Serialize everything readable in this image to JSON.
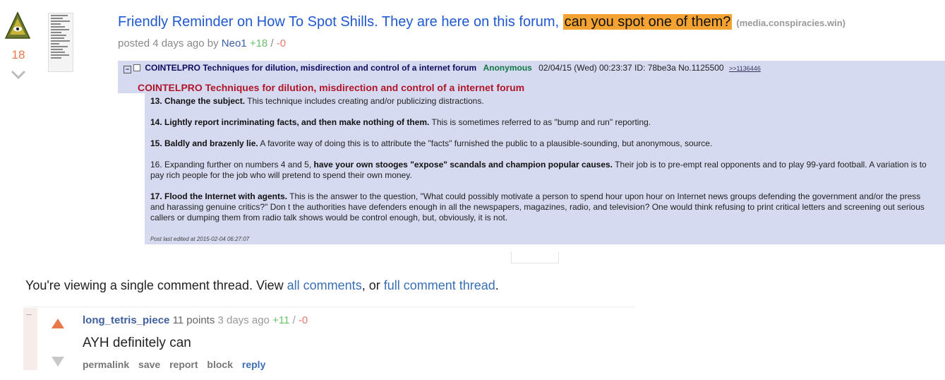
{
  "post": {
    "score": "18",
    "title_main": "Friendly Reminder on How To Spot Shills. They are here on this forum, ",
    "title_highlight": "can you spot one of them?",
    "domain": "(media.conspiracies.win)",
    "posted_prefix": "posted 4 days ago by",
    "author": "Neo1",
    "upvotes": "+18",
    "separator": "/",
    "downvotes": "-0"
  },
  "image": {
    "header_title": "COINTELPRO Techniques for dilution, misdirection and control of a internet forum",
    "header_name": "Anonymous",
    "header_meta": "02/04/15 (Wed) 00:23:37 ID: 78be3a No.1125500",
    "header_ref": ">>1136446",
    "subject": "COINTELPRO Techniques for dilution, misdirection and control of a internet forum",
    "items": [
      {
        "bold": "13. Change the subject.",
        "text": " This technique includes creating and/or publicizing distractions."
      },
      {
        "bold": "14. Lightly report incriminating facts, and then make nothing of them.",
        "text": " This is sometimes referred to as \"bump and run\" reporting."
      },
      {
        "bold": "15. Baldly and brazenly lie.",
        "text": " A favorite way of doing this is to attribute the \"facts\" furnished the public to a plausible-sounding, but anonymous, source."
      },
      {
        "pre": "16. Expanding further on numbers 4 and 5, ",
        "bold": "have your own stooges \"expose\" scandals and champion popular causes.",
        "text": " Their job is to pre-empt real opponents and to play 99-yard football. A variation is to pay rich people for the job who will pretend to spend their own money."
      },
      {
        "bold": "17. Flood the Internet with agents.",
        "text": " This is the answer to the question, \"What could possibly motivate a person to spend hour upon hour on Internet news groups defending the government and/or the press and harassing genuine critics?\" Don t the authorities have defenders enough in all the newspapers, magazines, radio, and television? One would think refusing to print critical letters and screening out serious callers or dumping them from radio talk shows would be control enough, but, obviously, it is not."
      }
    ],
    "edited": "Post last edited at 2015-02-04 06:27:07"
  },
  "thread_note": {
    "prefix": "You're viewing a single comment thread. View ",
    "link1": "all comments",
    "middle": ", or ",
    "link2": "full comment thread",
    "suffix": "."
  },
  "comment": {
    "collapse": "–",
    "user": "long_tetris_piece",
    "points": "11 points",
    "time": "3 days ago",
    "upvotes": "+11",
    "separator": "/",
    "downvotes": "-0",
    "body": "AYH definitely can",
    "actions": {
      "permalink": "permalink",
      "save": "save",
      "report": "report",
      "block": "block",
      "reply": "reply"
    }
  },
  "colors": {
    "accent_upvote": "#e8774a",
    "link_blue": "#1f58d1",
    "highlight": "#f4a332",
    "image_bg": "#d6daf0"
  }
}
